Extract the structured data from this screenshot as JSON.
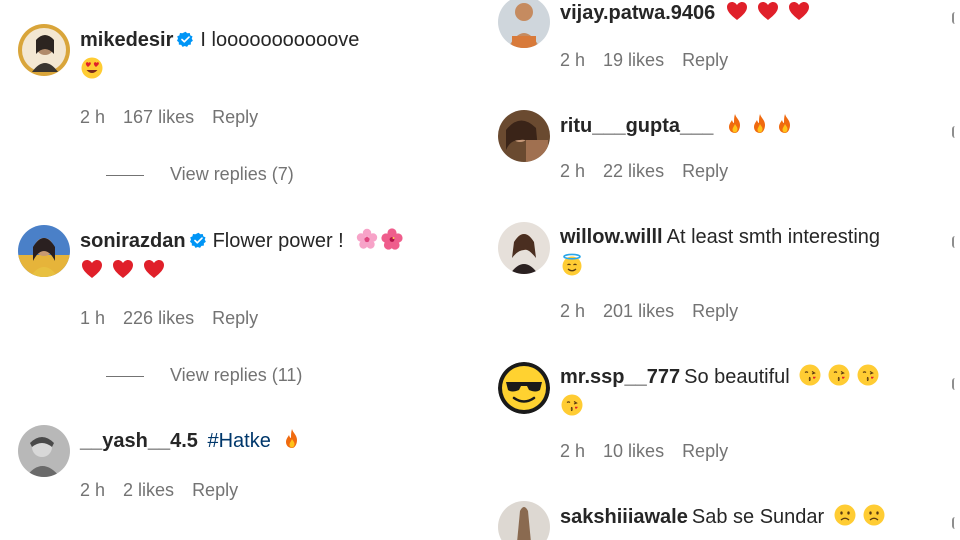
{
  "left_column": [
    {
      "username": "mikedesir",
      "verified": true,
      "text": "I looooooooooove",
      "line2_emojis": [
        "heart-eyes"
      ],
      "time": "2 h",
      "likes": "167 likes",
      "reply": "Reply",
      "view_replies": "View replies (7)"
    },
    {
      "username": "sonirazdan",
      "verified": true,
      "text": "Flower power !",
      "line1_emojis": [
        "cherry-blossom",
        "hibiscus"
      ],
      "line2_emojis": [
        "red-heart",
        "red-heart",
        "red-heart"
      ],
      "time": "1 h",
      "likes": "226 likes",
      "reply": "Reply",
      "view_replies": "View replies (11)"
    },
    {
      "username": "__yash__4.5",
      "verified": false,
      "tag": "#Hatke",
      "line1_emojis": [
        "fire"
      ],
      "time": "2 h",
      "likes": "2 likes",
      "reply": "Reply"
    }
  ],
  "right_column": [
    {
      "username": "vijay.patwa.9406",
      "line1_emojis": [
        "red-heart",
        "red-heart",
        "red-heart"
      ],
      "time": "2 h",
      "likes": "19 likes",
      "reply": "Reply"
    },
    {
      "username": "ritu___gupta___",
      "line1_emojis": [
        "fire",
        "fire",
        "fire"
      ],
      "time": "2 h",
      "likes": "22 likes",
      "reply": "Reply"
    },
    {
      "username": "willow.willl",
      "text": "At least smth interesting",
      "line2_emojis": [
        "halo-face"
      ],
      "time": "2 h",
      "likes": "201 likes",
      "reply": "Reply"
    },
    {
      "username": "mr.ssp__777",
      "text": "So beautiful",
      "line1_emojis": [
        "kissing-face",
        "kissing-face",
        "kissing-face"
      ],
      "line2_emojis": [
        "kissing-face"
      ],
      "time": "2 h",
      "likes": "10 likes",
      "reply": "Reply"
    },
    {
      "username": "sakshiiiawale",
      "text": "Sab se Sundar",
      "line1_emojis": [
        "frowning-face",
        "frowning-face"
      ]
    }
  ],
  "colors": {
    "text": "#262626",
    "meta": "#737373",
    "link": "#00376b",
    "verified": "#0095f6"
  }
}
